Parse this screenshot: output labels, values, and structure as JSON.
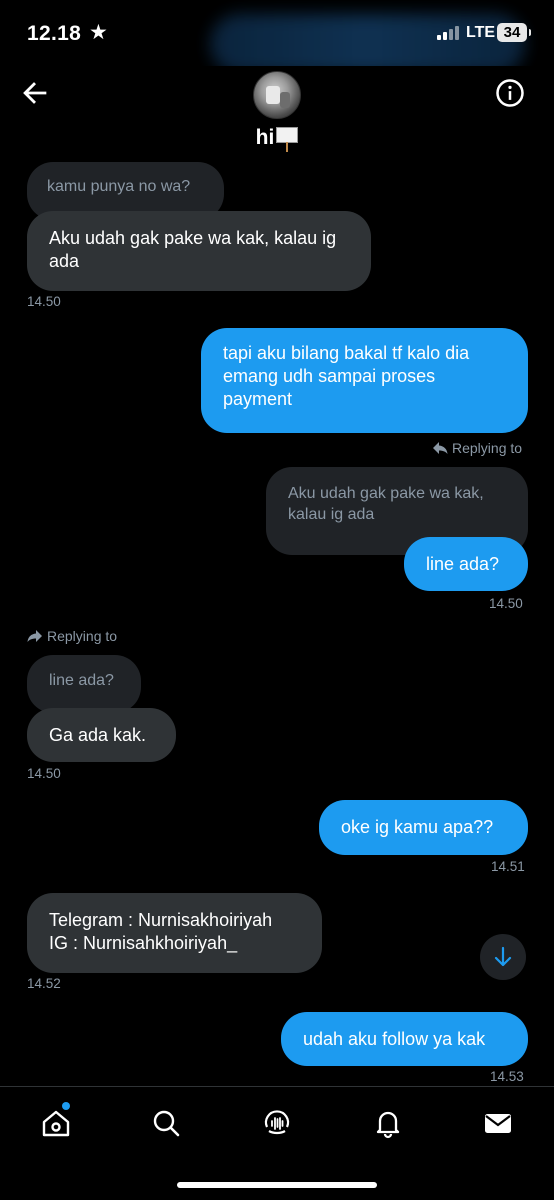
{
  "status_bar": {
    "time": "12.18",
    "network": "LTE",
    "battery": "34"
  },
  "header": {
    "title": "hi"
  },
  "messages": {
    "m1_quote": "kamu punya no wa?",
    "m1_text": "Aku udah gak pake wa kak, kalau ig ada",
    "m1_time": "14.50",
    "m2_text": "tapi aku bilang bakal tf kalo dia emang udh sampai proses payment",
    "m3_reply_label": "Replying to",
    "m3_quote": "Aku udah gak pake wa kak, kalau ig ada",
    "m3_text": "line ada?",
    "m3_time": "14.50",
    "m4_reply_label": "Replying to",
    "m4_quote": "line ada?",
    "m4_text": "Ga ada kak.",
    "m4_time": "14.50",
    "m5_text": "oke ig kamu apa??",
    "m5_time": "14.51",
    "m6_line1": "Telegram : Nurnisakhoiriyah",
    "m6_line2": "IG : Nurnisahkhoiriyah_",
    "m6_time": "14.52",
    "m7_text": "udah aku follow ya kak",
    "m7_time": "14.53"
  },
  "nav": {
    "items": [
      "home-icon",
      "search-icon",
      "spaces-icon",
      "notifications-icon",
      "messages-icon"
    ]
  },
  "colors": {
    "accent": "#1d9bf0",
    "incoming_bubble": "#2f3336",
    "background": "#000000"
  }
}
